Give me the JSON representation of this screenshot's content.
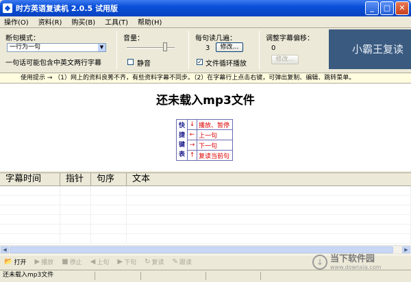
{
  "window": {
    "title": "时方英语复读机 2.0.5 试用版",
    "minimize": "_",
    "maximize": "□",
    "close": "✕"
  },
  "menu": [
    "操作(O)",
    "资料(R)",
    "购买(B)",
    "工具(T)",
    "帮助(H)"
  ],
  "controls": {
    "sentence_mode_label": "断句模式：",
    "sentence_mode_value": "一行为一句",
    "sentence_mode_hint": "一句话可能包含中英文两行字幕",
    "volume_label": "音量：",
    "mute_label": "静音",
    "mute_checked": false,
    "repeat_label": "每句读几遍：",
    "repeat_count": "3",
    "repeat_modify": "修改…",
    "loop_label": "文件循环播放",
    "loop_checked": true,
    "offset_label": "调整字幕偏移：",
    "offset_value": "0",
    "offset_modify": "修改…",
    "banner_text": "小霸王复读"
  },
  "tip": "使用提示 → （1）网上的资料良莠不齐，有些资料字幕不同步。（2）在字幕行上点击右键，可弹出复制、编辑、跳转菜单。",
  "main": {
    "headline": "还未载入mp3文件",
    "shortcuts_title": [
      "快",
      "捷",
      "键",
      "表"
    ],
    "shortcuts": [
      {
        "key": "↓",
        "action": "播放、暂停"
      },
      {
        "key": "←",
        "action": "上一句"
      },
      {
        "key": "→",
        "action": "下一句"
      },
      {
        "key": "↑",
        "action": "复读当前句"
      }
    ]
  },
  "grid": {
    "columns": [
      "字幕时间",
      "指针",
      "句序",
      "文本"
    ]
  },
  "toolbar": [
    {
      "icon": "📂",
      "label": "打开",
      "enabled": true
    },
    {
      "icon": "▶",
      "label": "播放",
      "enabled": false
    },
    {
      "icon": "■",
      "label": "停止",
      "enabled": false
    },
    {
      "icon": "◀",
      "label": "上句",
      "enabled": false
    },
    {
      "icon": "▶",
      "label": "下句",
      "enabled": false
    },
    {
      "icon": "↻",
      "label": "复读",
      "enabled": false
    },
    {
      "icon": "✎",
      "label": "跟读",
      "enabled": false
    }
  ],
  "status": "还未载入mp3文件",
  "watermark": {
    "text1": "当下软件园",
    "text2": "www.downxia.com"
  }
}
